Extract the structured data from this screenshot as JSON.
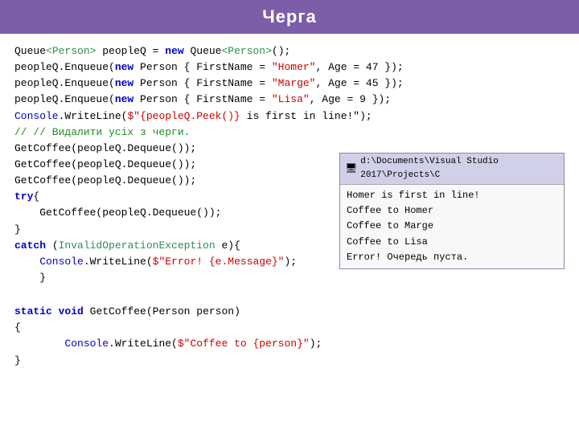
{
  "title": "Черга",
  "titleBg": "#7b5ea7",
  "code": {
    "lines": [
      {
        "id": "l1",
        "parts": [
          {
            "text": "Queue",
            "cls": "plain"
          },
          {
            "text": "<Person>",
            "cls": "type"
          },
          {
            "text": " peopleQ = ",
            "cls": "plain"
          },
          {
            "text": "new",
            "cls": "kw"
          },
          {
            "text": " Queue",
            "cls": "plain"
          },
          {
            "text": "<Person>",
            "cls": "type"
          },
          {
            "text": "();",
            "cls": "plain"
          }
        ]
      },
      {
        "id": "l2",
        "parts": [
          {
            "text": "peopleQ.Enqueue(",
            "cls": "plain"
          },
          {
            "text": "new",
            "cls": "kw"
          },
          {
            "text": " Person { FirstName = ",
            "cls": "plain"
          },
          {
            "text": "\"Homer\"",
            "cls": "string"
          },
          {
            "text": ", Age = 47 });",
            "cls": "plain"
          }
        ]
      },
      {
        "id": "l3",
        "parts": [
          {
            "text": "peopleQ.Enqueue(",
            "cls": "plain"
          },
          {
            "text": "new",
            "cls": "kw"
          },
          {
            "text": " Person { FirstName = ",
            "cls": "plain"
          },
          {
            "text": "\"Marge\"",
            "cls": "string"
          },
          {
            "text": ", Age = 45 });",
            "cls": "plain"
          }
        ]
      },
      {
        "id": "l4",
        "parts": [
          {
            "text": "peopleQ.Enqueue(",
            "cls": "plain"
          },
          {
            "text": "new",
            "cls": "kw"
          },
          {
            "text": " Person { FirstName = ",
            "cls": "plain"
          },
          {
            "text": "\"Lisa\"",
            "cls": "string"
          },
          {
            "text": ", Age = 9 });",
            "cls": "plain"
          }
        ]
      },
      {
        "id": "l5",
        "parts": [
          {
            "text": "Console",
            "cls": "console"
          },
          {
            "text": ".WriteLine(",
            "cls": "plain"
          },
          {
            "text": "$\"{peopleQ.Peek()} ",
            "cls": "string"
          },
          {
            "text": "is first in line!",
            "cls": "plain"
          },
          {
            "text": "\");",
            "cls": "plain"
          }
        ]
      },
      {
        "id": "l6",
        "parts": [
          {
            "text": "// // Видалити усіх з черги.",
            "cls": "comment"
          }
        ]
      },
      {
        "id": "l7",
        "parts": [
          {
            "text": "GetCoffee(peopleQ.Dequeue());",
            "cls": "plain"
          }
        ]
      },
      {
        "id": "l8",
        "parts": [
          {
            "text": "GetCoffee(peopleQ.Dequeue());",
            "cls": "plain"
          }
        ]
      },
      {
        "id": "l9",
        "parts": [
          {
            "text": "GetCoffee(peopleQ.Dequeue());",
            "cls": "plain"
          }
        ]
      },
      {
        "id": "l10",
        "parts": [
          {
            "text": "try",
            "cls": "kw"
          },
          {
            "text": "{",
            "cls": "plain"
          }
        ]
      },
      {
        "id": "l11",
        "parts": [
          {
            "text": "    GetCoffee(peopleQ.Dequeue());",
            "cls": "plain"
          }
        ]
      },
      {
        "id": "l12",
        "parts": [
          {
            "text": "}",
            "cls": "plain"
          }
        ]
      },
      {
        "id": "l13",
        "parts": [
          {
            "text": "catch",
            "cls": "kw"
          },
          {
            "text": " (",
            "cls": "plain"
          },
          {
            "text": "InvalidOperationException",
            "cls": "type"
          },
          {
            "text": " e){",
            "cls": "plain"
          }
        ]
      },
      {
        "id": "l14",
        "parts": [
          {
            "text": "    Console",
            "cls": "console"
          },
          {
            "text": ".WriteLine(",
            "cls": "plain"
          },
          {
            "text": "$\"Error! {e.Message}\"",
            "cls": "string"
          },
          {
            "text": ");",
            "cls": "plain"
          }
        ]
      },
      {
        "id": "l15",
        "parts": [
          {
            "text": "    }",
            "cls": "plain"
          }
        ]
      }
    ],
    "staticSection": [
      {
        "id": "s1",
        "parts": [
          {
            "text": "static",
            "cls": "kw"
          },
          {
            "text": " ",
            "cls": "plain"
          },
          {
            "text": "void",
            "cls": "kw"
          },
          {
            "text": " GetCoffee(Person person)",
            "cls": "plain"
          }
        ]
      },
      {
        "id": "s2",
        "parts": [
          {
            "text": "{",
            "cls": "plain"
          }
        ]
      },
      {
        "id": "s3",
        "parts": [
          {
            "text": "        Console",
            "cls": "console"
          },
          {
            "text": ".WriteLine(",
            "cls": "plain"
          },
          {
            "text": "$\"Coffee to {person}\"",
            "cls": "string"
          },
          {
            "text": ");",
            "cls": "plain"
          }
        ]
      },
      {
        "id": "s4",
        "parts": [
          {
            "text": "}",
            "cls": "plain"
          }
        ]
      }
    ]
  },
  "outputBox": {
    "title": "d:\\Documents\\Visual Studio 2017\\Projects\\C",
    "lines": [
      "Homer is first in line!",
      "Coffee to Homer",
      "Coffee to Marge",
      "Coffee to Lisa",
      "Error! Очередь пуста."
    ]
  }
}
